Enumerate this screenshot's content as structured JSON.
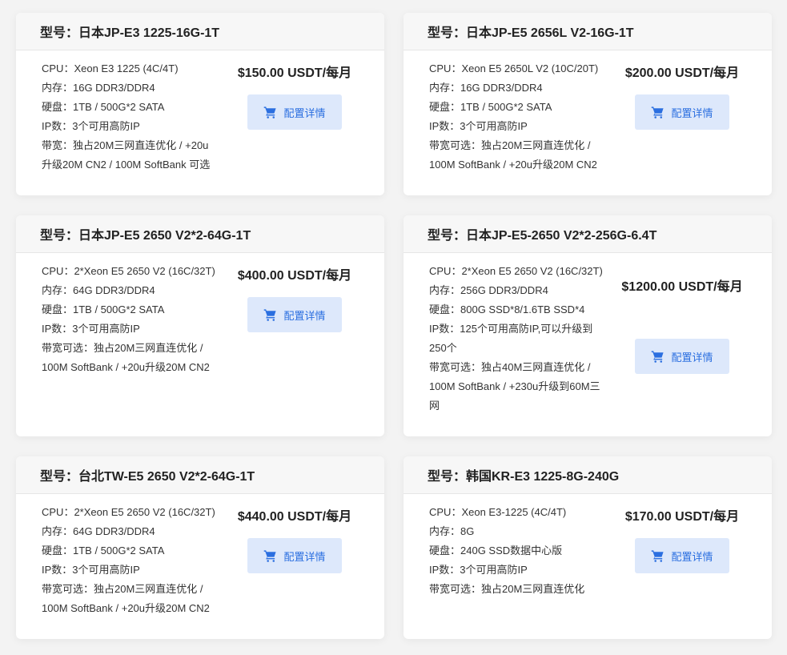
{
  "button_label": "配置详情",
  "accent_color": "#2b6fe0",
  "button_bg": "#dde8fb",
  "cards": [
    {
      "title": "型号：日本JP-E3 1225-16G-1T",
      "price": "$150.00 USDT/每月",
      "specs": [
        "CPU：Xeon E3 1225 (4C/4T)",
        "内存：16G DDR3/DDR4",
        "硬盘：1TB / 500G*2 SATA",
        "IP数：3个可用高防IP",
        "带宽：独占20M三网直连优化 / +20u",
        "升级20M CN2 / 100M SoftBank 可选"
      ]
    },
    {
      "title": "型号：日本JP-E5 2656L V2-16G-1T",
      "price": "$200.00 USDT/每月",
      "specs": [
        "CPU：Xeon E5 2650L V2 (10C/20T)",
        "内存：16G DDR3/DDR4",
        "硬盘：1TB / 500G*2 SATA",
        "IP数：3个可用高防IP",
        "带宽可选：独占20M三网直连优化 /",
        "100M SoftBank / +20u升级20M CN2"
      ]
    },
    {
      "title": "型号：日本JP-E5 2650 V2*2-64G-1T",
      "price": "$400.00 USDT/每月",
      "specs": [
        "CPU：2*Xeon E5 2650 V2 (16C/32T)",
        "内存：64G DDR3/DDR4",
        "硬盘：1TB / 500G*2 SATA",
        "IP数：3个可用高防IP",
        "带宽可选：独占20M三网直连优化 /",
        "100M SoftBank / +20u升级20M CN2"
      ]
    },
    {
      "title": "型号：日本JP-E5-2650 V2*2-256G-6.4T",
      "price": "$1200.00 USDT/每月",
      "specs": [
        "CPU：2*Xeon E5 2650 V2 (16C/32T)",
        "内存：256G DDR3/DDR4",
        "硬盘：800G SSD*8/1.6TB SSD*4",
        "IP数：125个可用高防IP,可以升级到",
        "250个",
        "带宽可选：独占40M三网直连优化 /",
        "100M SoftBank / +230u升级到60M三",
        "网"
      ]
    },
    {
      "title": "型号：台北TW-E5 2650 V2*2-64G-1T",
      "price": "$440.00 USDT/每月",
      "specs": [
        "CPU：2*Xeon E5 2650 V2 (16C/32T)",
        "内存：64G DDR3/DDR4",
        "硬盘：1TB / 500G*2 SATA",
        "IP数：3个可用高防IP",
        "带宽可选：独占20M三网直连优化 /",
        "100M SoftBank / +20u升级20M CN2"
      ]
    },
    {
      "title": "型号：韩国KR-E3 1225-8G-240G",
      "price": "$170.00 USDT/每月",
      "specs": [
        "CPU：Xeon E3-1225 (4C/4T)",
        "内存：8G",
        "硬盘：240G SSD数据中心版",
        "IP数：3个可用高防IP",
        "带宽可选：独占20M三网直连优化"
      ]
    }
  ]
}
